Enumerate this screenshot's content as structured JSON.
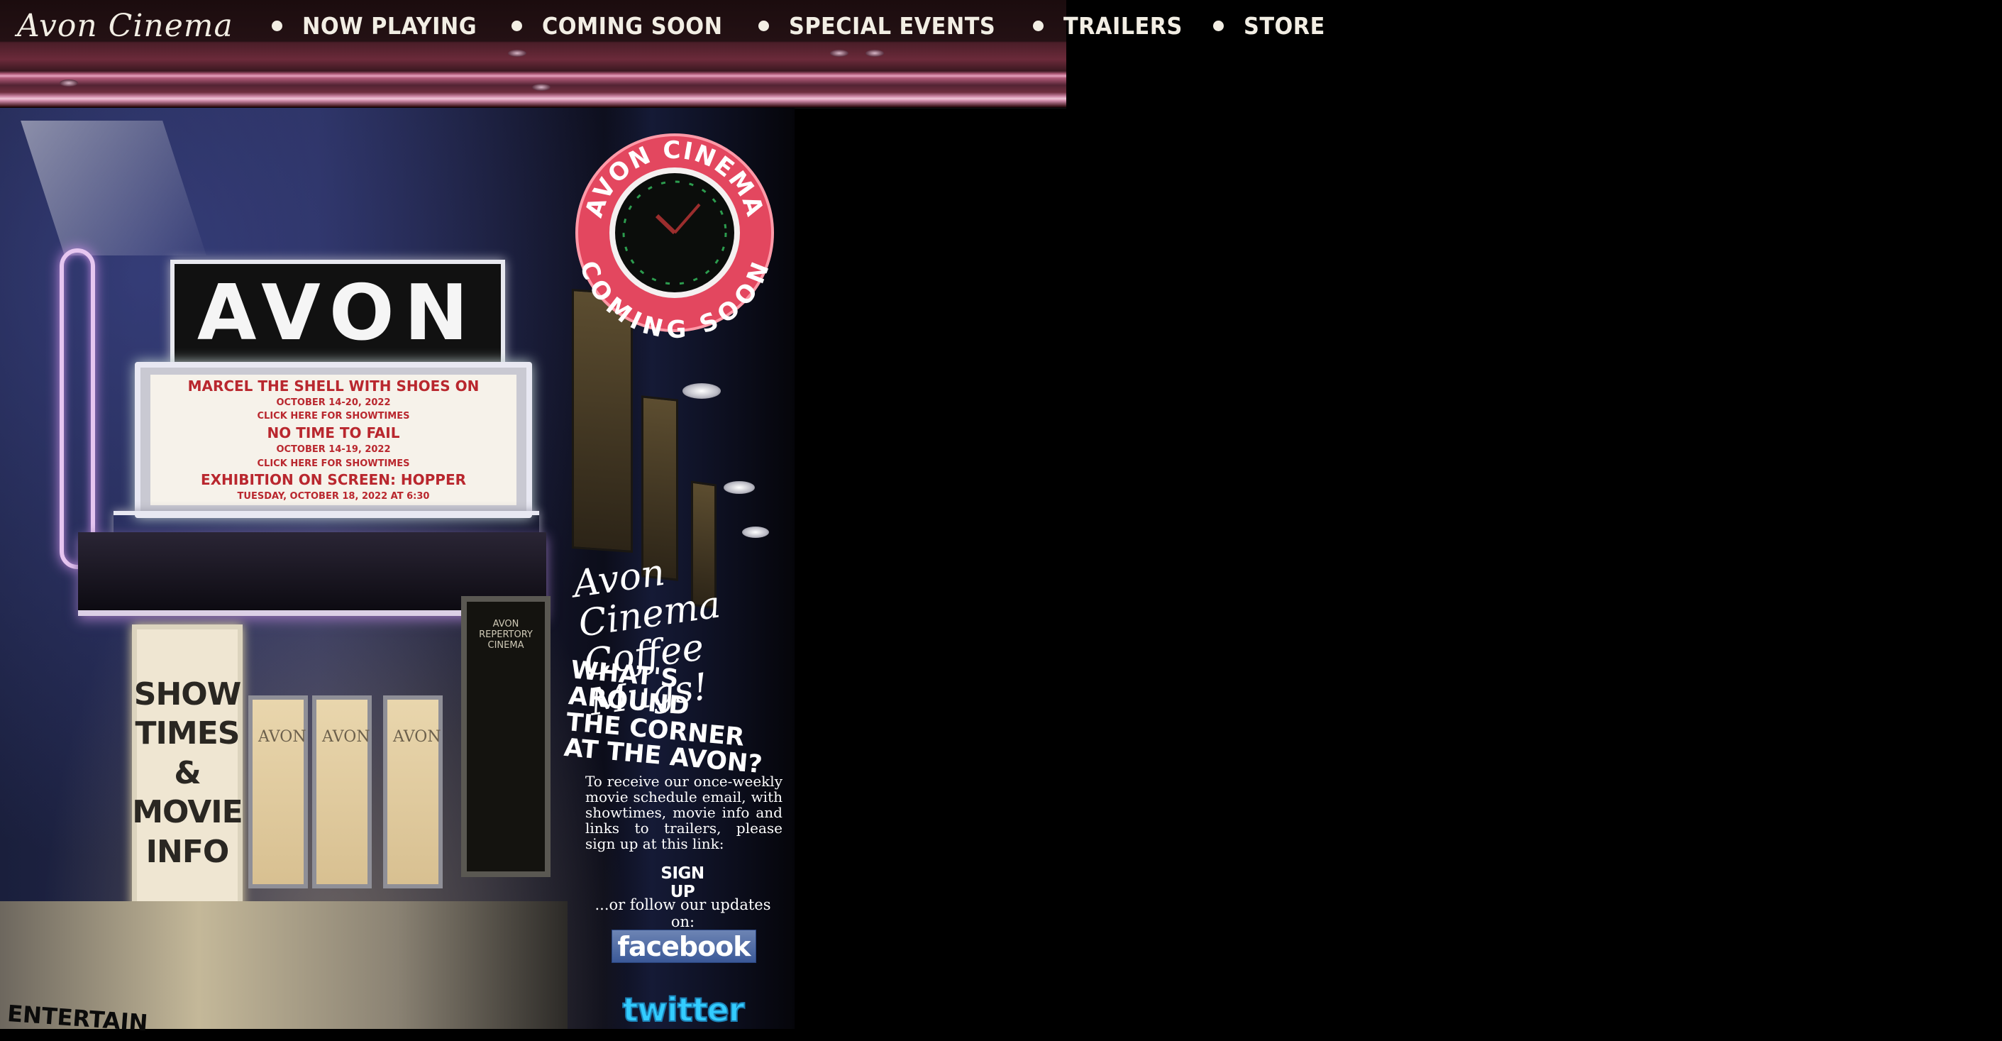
{
  "nav": {
    "brand": "Avon Cinema",
    "items": [
      "NOW PLAYING",
      "COMING SOON",
      "SPECIAL EVENTS",
      "TRAILERS",
      "STORE"
    ]
  },
  "facade": {
    "sign_word": "AVON",
    "marquee": [
      {
        "text": "MARCEL THE SHELL WITH SHOES ON",
        "kind": "title"
      },
      {
        "text": "OCTOBER 14-20, 2022",
        "kind": "sub"
      },
      {
        "text": "CLICK HERE FOR SHOWTIMES",
        "kind": "sub"
      },
      {
        "text": "NO TIME TO FAIL",
        "kind": "title"
      },
      {
        "text": "OCTOBER 14-19, 2022",
        "kind": "sub"
      },
      {
        "text": "CLICK HERE FOR SHOWTIMES",
        "kind": "sub"
      },
      {
        "text": "EXHIBITION ON SCREEN: HOPPER",
        "kind": "title"
      },
      {
        "text": "TUESDAY, OCTOBER 18, 2022 AT 6:30",
        "kind": "sub"
      }
    ],
    "showtimes_words": [
      "SHOW",
      "TIMES",
      "&",
      "MOVIE",
      "INFO"
    ],
    "door_label": "AVON",
    "poster_case_label": "AVON REPERTORY CINEMA",
    "bottom_text": "ENTERTAIN"
  },
  "clock": {
    "top_text": "AVON CINEMA",
    "bottom_text": "COMING SOON"
  },
  "sidebar": {
    "mugs_line1": "Avon Cinema",
    "mugs_line2": "Coffee Mugs!",
    "around_line1": "WHAT'S AROUND",
    "around_line2": "THE CORNER",
    "around_line3": "AT THE AVON?",
    "signup_text": "To receive our once-weekly movie schedule email, with showtimes, movie info and links to trailers, please sign up at this link:",
    "signup_label": "SIGN UP",
    "follow_text": "...or follow our updates on:",
    "facebook_label": "facebook",
    "twitter_label": "twitter"
  },
  "colors": {
    "background": "#000000",
    "marquee_text": "#b9272e",
    "neon_pink": "#e35a78",
    "facebook_blue": "#3b5998",
    "twitter_blue": "#33ccff"
  }
}
